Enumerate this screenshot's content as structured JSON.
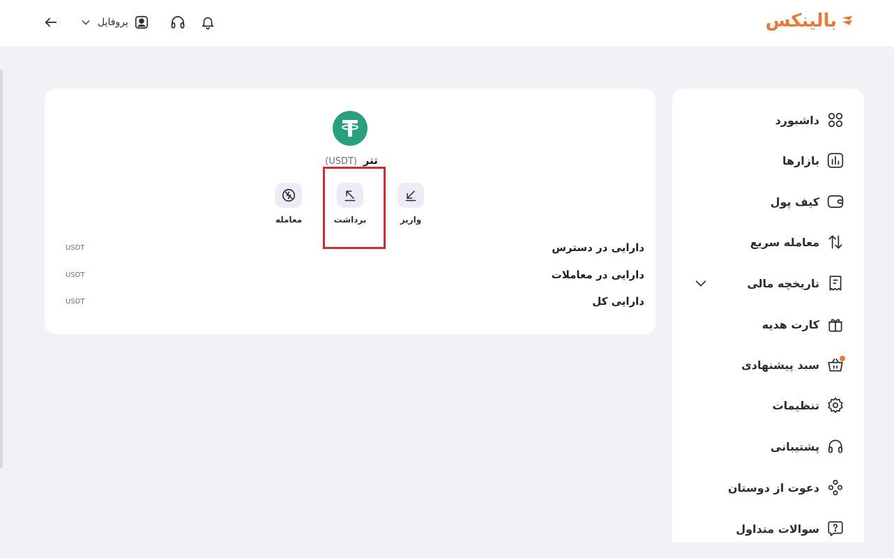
{
  "header": {
    "brand": "بالینکس",
    "profile_label": "پروفایل",
    "colors": {
      "brand": "#e77a3a"
    }
  },
  "sidebar": {
    "items": [
      {
        "label": "داشبورد",
        "icon": "grid-icon"
      },
      {
        "label": "بازارها",
        "icon": "chart-icon"
      },
      {
        "label": "کیف پول",
        "icon": "wallet-icon"
      },
      {
        "label": "معامله سریع",
        "icon": "swap-icon"
      },
      {
        "label": "تاریخچه مالی",
        "icon": "receipt-icon"
      },
      {
        "label": "کارت هدیه",
        "icon": "gift-icon"
      },
      {
        "label": "سبد پیشنهادی",
        "icon": "basket-icon"
      },
      {
        "label": "تنظیمات",
        "icon": "gear-icon"
      },
      {
        "label": "پشتیبانی",
        "icon": "headset-icon"
      },
      {
        "label": "دعوت از دوستان",
        "icon": "users-icon"
      },
      {
        "label": "سوالات متداول",
        "icon": "question-icon"
      }
    ]
  },
  "asset": {
    "name": "تتر",
    "symbol": "(USDT)",
    "actions": {
      "deposit": "واریز",
      "withdraw": "برداشت",
      "trade": "معامله"
    },
    "balances": [
      {
        "label": "دارایی در دسترس",
        "unit": "USDT"
      },
      {
        "label": "دارایی در معاملات",
        "unit": "USDT"
      },
      {
        "label": "دارایی کل",
        "unit": "USDT"
      }
    ]
  }
}
